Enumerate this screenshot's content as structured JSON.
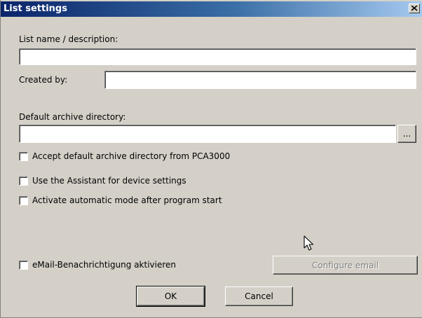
{
  "window": {
    "title": "List settings"
  },
  "form": {
    "list_name_label": "List name / description:",
    "list_name_value": "",
    "created_by_label": "Created by:",
    "created_by_value": "",
    "archive_dir_label": "Default archive directory:",
    "archive_dir_value": "",
    "browse_label": "..."
  },
  "options": {
    "accept_default_archive": {
      "label": "Accept default archive directory from PCA3000",
      "checked": false
    },
    "use_assistant": {
      "label": "Use the Assistant for device settings",
      "checked": false
    },
    "activate_automatic": {
      "label": "Activate automatic mode after program start",
      "checked": false
    },
    "email_notification": {
      "label": "eMail-Benachrichtigung aktivieren",
      "checked": false
    }
  },
  "buttons": {
    "configure_email": "Configure email",
    "ok": "OK",
    "cancel": "Cancel"
  },
  "icons": {
    "close": "close-icon",
    "cursor": "mouse-pointer-icon"
  }
}
